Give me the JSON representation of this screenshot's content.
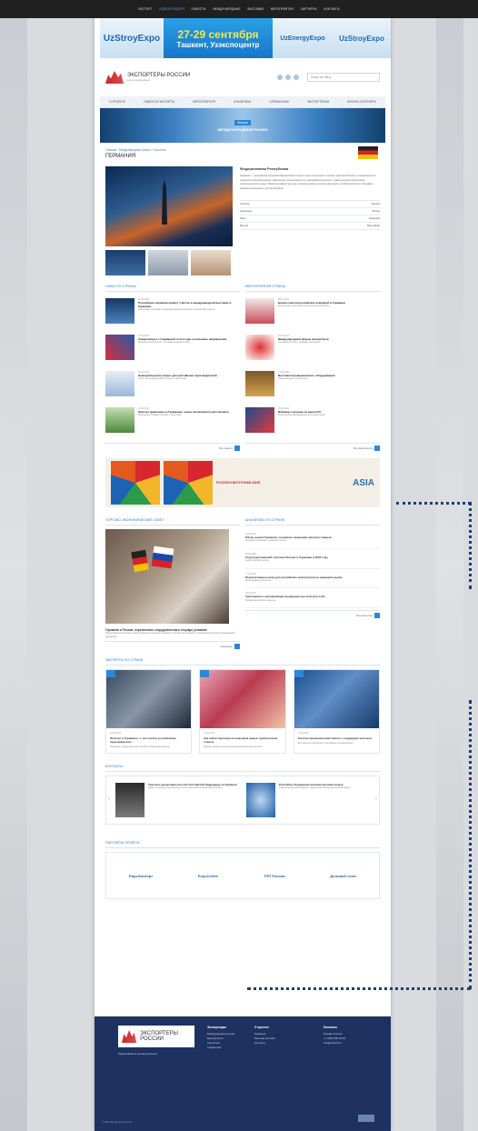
{
  "topbar": {
    "items": [
      "Eкспорт",
      "Неделя-Неделя",
      "Новости",
      "Международные",
      "Выставки",
      "Мероприятия",
      "Партнёры",
      "Контакты"
    ]
  },
  "banner": {
    "left_logo": "UzStroyExpo",
    "dates": "27-29 сентября",
    "place": "Ташкент, Узэкспоцентр",
    "mid_logo": "UzEnergyExpo",
    "right_logo": "UzStroyExpo"
  },
  "header": {
    "logo_title": "ЭКСПОРТЕРЫ РОССИИ",
    "logo_sub": "всё для экспортёров",
    "search_placeholder": "Поиск по сайту"
  },
  "nav": [
    "О проекте",
    "Новости Экспорта",
    "Мероприятия",
    "Аналитика",
    "Справочник",
    "Экспортерам",
    "Бизнес-партнеры"
  ],
  "hero": {
    "tag": "Экспорт",
    "title": "Международные рынки"
  },
  "breadcrumb": {
    "home": "Главная",
    "section": "Международные рынки",
    "current": "Германия"
  },
  "country": {
    "title": "Германия",
    "info_heading": "Федеративная Республика",
    "info_text": "Германия — крупнейшая экономика Европейского союза и один из ключевых торговых партнёров России. Страна является лидером в машиностроении, химической промышленности и автомобилестроении, а также крупным импортёром энергоресурсов и сырья. Развитая инфраструктура, высокий уровень доходов населения и стабильный спрос открывают широкие возможности для экспортёров.",
    "table": [
      {
        "k": "Столица",
        "v": "Берлин"
      },
      {
        "k": "Население",
        "v": "83 млн"
      },
      {
        "k": "Язык",
        "v": "Немецкий"
      },
      {
        "k": "Валюта",
        "v": "Евро (EUR)"
      }
    ]
  },
  "news_left": {
    "heading": "Новости страны",
    "items": [
      {
        "date": "01.03.2023",
        "title": "Российские компании примут участие в международной выставке в Германии",
        "desc": "Экспортёры представят продукцию машиностроения и химической отрасли."
      },
      {
        "date": "27.02.2023",
        "title": "Товарооборот с Германией: итоги года и ключевые направления",
        "desc": "Эксперты отметили рост поставок продовольствия."
      },
      {
        "date": "21.02.2023",
        "title": "Немецкий рынок открыт для российских производителей",
        "desc": "Спрос на продукцию АПК остаётся стабильным."
      },
      {
        "date": "15.02.2023",
        "title": "Экспорт древесины в Германию: новые возможности для бизнеса",
        "desc": "Обсуждены условия поставок и логистика."
      }
    ],
    "more": "Все новости"
  },
  "news_right": {
    "heading": "Мероприятия страны",
    "items": [
      {
        "date": "28.02.2023",
        "title": "Бизнес-миссия российских компаний в Германии",
        "desc": "Регистрация участников открыта до конца месяца."
      },
      {
        "date": "20.02.2023",
        "title": "Международный форум экспортёров",
        "desc": "Пленарная сессия и деловые переговоры."
      },
      {
        "date": "14.02.2023",
        "title": "Выставка промышленного оборудования",
        "desc": "Национальный стенд России."
      },
      {
        "date": "09.02.2023",
        "title": "Вебинар о выходе на рынок ЕС",
        "desc": "Практические рекомендации для экспортёров."
      }
    ],
    "more": "Все мероприятия"
  },
  "ad": {
    "text": "РОССИЯ И ВОСТОЧНАЯ АЗИЯ",
    "brand": "ASIA"
  },
  "trade": {
    "heading": "Торгово-экономический совет",
    "title": "Германия и Россия: перспективы сотрудничества в текущих условиях",
    "desc": "Представители деловых кругов обсудили вопросы развития торговых отношений и расширения экспорта несырьевой продукции.",
    "more": "Подробнее"
  },
  "analytics": {
    "heading": "Аналитика по стране",
    "items": [
      {
        "date": "02.03.2023",
        "title": "Обзор рынка Германии: основные тенденции импорта товаров",
        "desc": "Ключевые категории и динамика спроса."
      },
      {
        "date": "24.02.2023",
        "title": "Структура внешней торговли России и Германии в 2022 году",
        "desc": "Аналитический доклад."
      },
      {
        "date": "17.02.2023",
        "title": "Перспективные ниши для российских экспортёров на немецком рынке",
        "desc": "Рекомендации экспертов."
      },
      {
        "date": "10.02.2023",
        "title": "Требования к сертификации продукции при экспорте в ЕС",
        "desc": "Нормативная база и практика."
      }
    ],
    "more": "Вся аналитика"
  },
  "experts": {
    "heading": "Эксперты по стране",
    "cards": [
      {
        "date": "01.03.2023",
        "title": "Экспорт в Германию: с чего начать российскому производителю",
        "desc": "Интервью с представителем торгового представительства."
      },
      {
        "date": "22.02.2023",
        "title": "Как найти партнёра на немецком рынке: практические советы",
        "desc": "Мнение эксперта по внешнеэкономической деятельности."
      },
      {
        "date": "13.02.2023",
        "title": "Торгово-промышленная палата о поддержке экспорта",
        "desc": "Инструменты поддержки и программы сопровождения."
      }
    ]
  },
  "contacts": {
    "heading": "Контакты",
    "items": [
      {
        "title": "Торговое представительство Российской Федерации в Германии",
        "desc": "Адрес, телефоны, электронная почта и часы работы представительства."
      },
      {
        "title": "Российско-Германская внешнеторговая палата",
        "desc": "Консультации для компаний, планирующих выход на немецкий рынок."
      }
    ]
  },
  "partners": {
    "heading": "Партнёры проекта",
    "items": [
      "ЕвроЭкспорт",
      "ExpoCentre",
      "ТПП России",
      "Деловой союз"
    ]
  },
  "footer": {
    "logo_title": "ЭКСПОРТЕРЫ РОССИИ",
    "note": "Подписывайтесь на нашу рассылку",
    "col1_title": "Экспортерам",
    "col1": [
      "Международные рынки",
      "Мероприятия",
      "Аналитика",
      "Справочник"
    ],
    "col2_title": "О проекте",
    "col2": [
      "Редакция",
      "Реклама на сайте",
      "Контакты"
    ],
    "col3_title": "Контакты",
    "col3": [
      "Москва, Россия",
      "+7 (495) 000-00-00",
      "info@exportrf.ru"
    ],
    "copy": "© 2023 Экспортеры России"
  }
}
